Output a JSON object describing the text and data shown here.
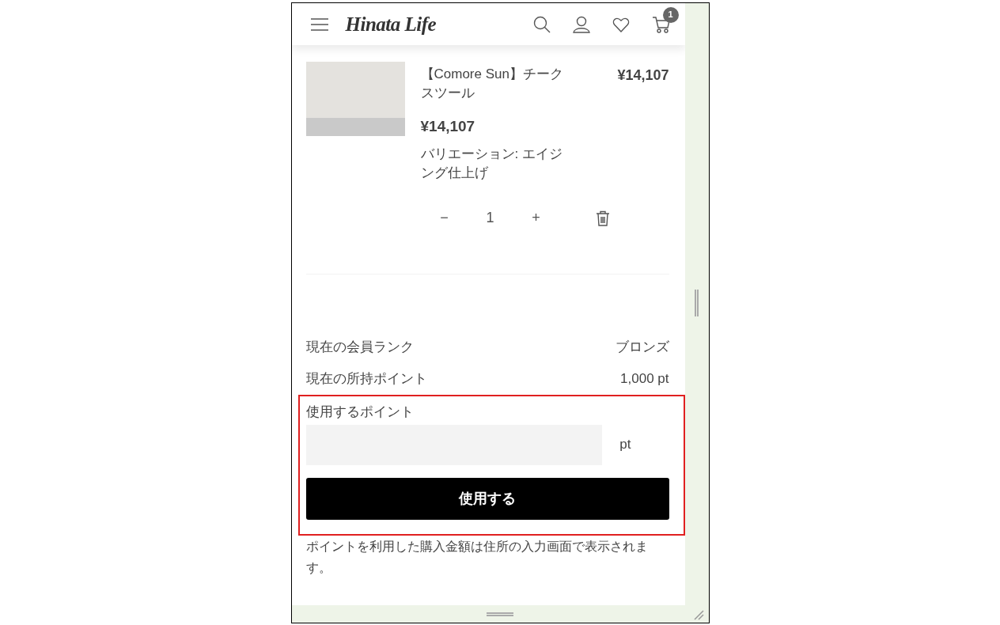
{
  "header": {
    "logo": "Hinata Life",
    "cart_count": "1"
  },
  "items": [
    {
      "title": "【Comore Sun】チークスツール",
      "line_total": "¥14,107",
      "price": "¥14,107",
      "variation": "バリエーション: エイジング仕上げ",
      "minus": "−",
      "quantity": "1",
      "plus": "+"
    }
  ],
  "member_rows": [
    {
      "label": "現在の会員ランク",
      "value": "ブロンズ"
    },
    {
      "label": "現在の所持ポイント",
      "value": "1,000 pt"
    }
  ],
  "points": {
    "label": "使用するポイント",
    "unit": "pt",
    "button": "使用する"
  },
  "note": "ポイントを利用した購入金額は住所の入力画面で表示されます。"
}
